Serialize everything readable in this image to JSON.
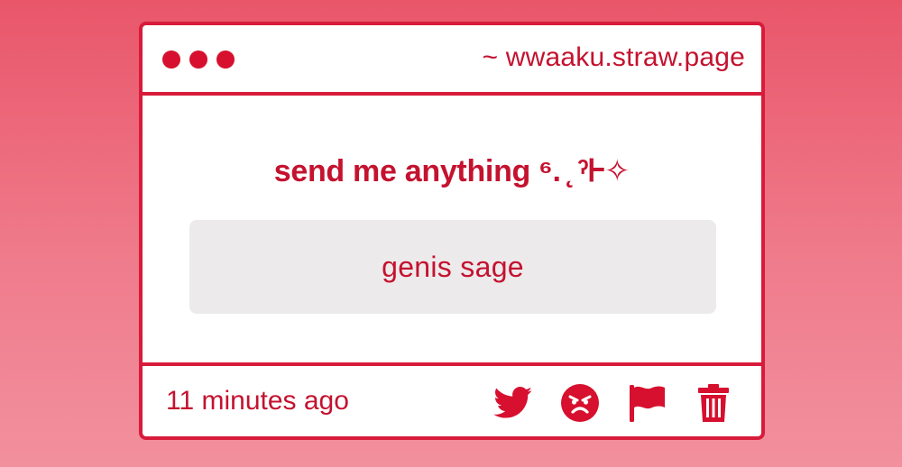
{
  "window": {
    "url": "~ wwaaku.straw.page"
  },
  "main": {
    "prompt": "send me anything ⁶. ̨ ˀᎰ✧",
    "message": "genis sage"
  },
  "footer": {
    "timestamp": "11 minutes ago",
    "icons": [
      "twitter-icon",
      "angry-face-icon",
      "flag-icon",
      "trash-icon"
    ]
  },
  "colors": {
    "accent": "#d81b3a",
    "text": "#c4122f",
    "message_bg": "#edeaeb",
    "page_bg_top": "#e9566a",
    "page_bg_bottom": "#f2909e"
  }
}
